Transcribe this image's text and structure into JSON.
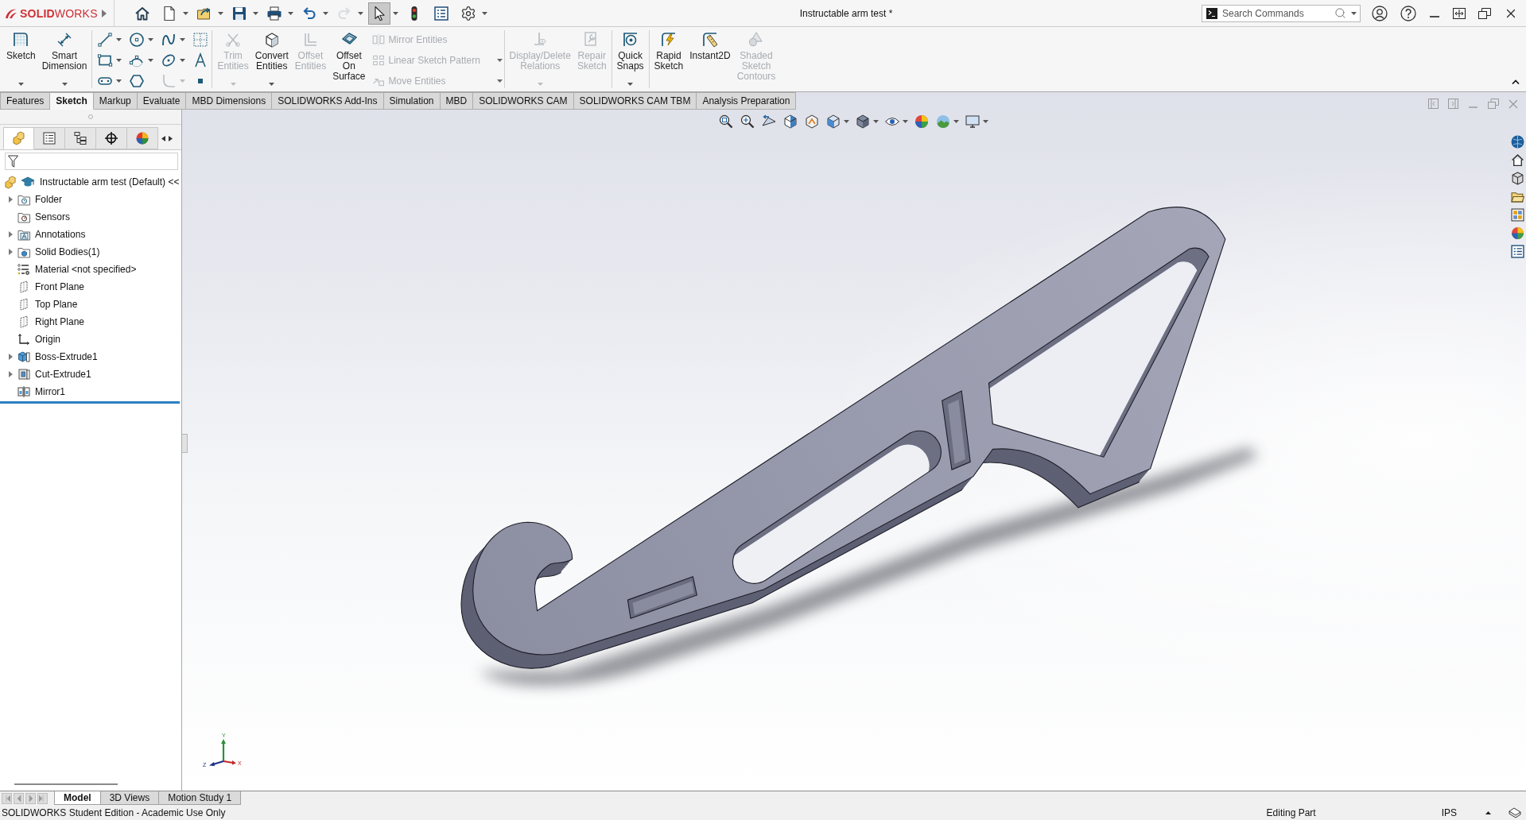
{
  "window": {
    "logo": "**SOLID**WORKS",
    "title": "Instructable arm test *"
  },
  "quick_access": [
    {
      "menu": false,
      "disabled": false,
      "pressed": false
    },
    {
      "menu": true,
      "disabled": false,
      "pressed": false
    },
    {
      "menu": true,
      "disabled": false,
      "pressed": false
    },
    {
      "menu": true,
      "disabled": false,
      "pressed": false
    },
    {
      "menu": true,
      "disabled": false,
      "pressed": false
    },
    {
      "menu": true,
      "disabled": false,
      "pressed": false
    },
    {
      "menu": true,
      "disabled": true,
      "pressed": false
    },
    {
      "menu": true,
      "disabled": false,
      "pressed": true
    },
    {
      "menu": false,
      "disabled": false,
      "pressed": false
    },
    {
      "menu": false,
      "disabled": false,
      "pressed": false
    },
    {
      "menu": true,
      "disabled": false,
      "pressed": false
    }
  ],
  "search": {
    "placeholder": "Search Commands"
  },
  "command_manager": {
    "groups": [
      {
        "items": [
          {
            "kind": "large",
            "label": "Sketch",
            "disabled": false,
            "menu": true
          },
          {
            "kind": "large",
            "label": "Smart Dimension",
            "disabled": false,
            "menu": true
          }
        ]
      },
      {
        "items": [
          {
            "kind": "tool",
            "disabled": false,
            "menu": true
          },
          {
            "kind": "tool",
            "disabled": false,
            "menu": true
          },
          {
            "kind": "tool",
            "disabled": false,
            "menu": true
          },
          {
            "kind": "tool",
            "disabled": false,
            "menu": false
          },
          {
            "kind": "tool",
            "disabled": false,
            "menu": true
          },
          {
            "kind": "tool",
            "disabled": false,
            "menu": true
          },
          {
            "kind": "tool",
            "disabled": false,
            "menu": true
          },
          {
            "kind": "tool",
            "disabled": false,
            "menu": false
          },
          {
            "kind": "tool",
            "disabled": false,
            "menu": true
          },
          {
            "kind": "tool",
            "disabled": false,
            "menu": false
          },
          {
            "kind": "tool",
            "disabled": true,
            "menu": true
          },
          {
            "kind": "tool",
            "disabled": false,
            "menu": false
          }
        ]
      },
      {
        "items": [
          {
            "kind": "large",
            "label": "Trim Entities",
            "disabled": true,
            "menu": true
          },
          {
            "kind": "large",
            "label": "Convert Entities",
            "disabled": false,
            "menu": true
          },
          {
            "kind": "large",
            "label": "Offset Entities",
            "disabled": true,
            "menu": false
          },
          {
            "kind": "large",
            "label": "Offset On Surface",
            "disabled": false,
            "menu": false
          },
          {
            "kind": "row",
            "label": "Mirror Entities",
            "disabled": true,
            "menu": false
          },
          {
            "kind": "row",
            "label": "Linear Sketch Pattern",
            "disabled": true,
            "menu": true
          },
          {
            "kind": "row",
            "label": "Move Entities",
            "disabled": true,
            "menu": true
          }
        ]
      },
      {
        "items": [
          {
            "kind": "large",
            "label": "Display/Delete Relations",
            "disabled": true,
            "menu": true
          },
          {
            "kind": "large",
            "label": "Repair Sketch",
            "disabled": true,
            "menu": false
          }
        ]
      },
      {
        "items": [
          {
            "kind": "large",
            "label": "Quick Snaps",
            "disabled": false,
            "menu": true
          }
        ]
      },
      {
        "items": [
          {
            "kind": "large",
            "label": "Rapid Sketch",
            "disabled": false,
            "menu": false
          },
          {
            "kind": "large",
            "label": "Instant2D",
            "disabled": false,
            "menu": false
          },
          {
            "kind": "large",
            "label": "Shaded Sketch Contours",
            "disabled": true,
            "menu": false
          }
        ]
      }
    ]
  },
  "command_tabs": [
    {
      "label": "Features",
      "selected": false
    },
    {
      "label": "Sketch",
      "selected": true
    },
    {
      "label": "Markup",
      "selected": false
    },
    {
      "label": "Evaluate",
      "selected": false
    },
    {
      "label": "MBD Dimensions",
      "selected": false
    },
    {
      "label": "SOLIDWORKS Add-Ins",
      "selected": false
    },
    {
      "label": "Simulation",
      "selected": false
    },
    {
      "label": "MBD",
      "selected": false
    },
    {
      "label": "SOLIDWORKS CAM",
      "selected": false
    },
    {
      "label": "SOLIDWORKS CAM TBM",
      "selected": false
    },
    {
      "label": "Analysis Preparation",
      "selected": false
    }
  ],
  "feature_manager": {
    "tabs": [
      {
        "selected": true
      },
      {
        "selected": false
      },
      {
        "selected": false
      },
      {
        "selected": false
      },
      {
        "selected": false
      }
    ],
    "root": "Instructable arm test (Default) <<",
    "items": [
      {
        "label": "Folder",
        "kind": "folder",
        "expandable": true
      },
      {
        "label": "Sensors",
        "kind": "sensors",
        "expandable": false
      },
      {
        "label": "Annotations",
        "kind": "annotations",
        "expandable": true
      },
      {
        "label": "Solid Bodies(1)",
        "kind": "bodies",
        "expandable": true
      },
      {
        "label": "Material <not specified>",
        "kind": "material",
        "expandable": false
      },
      {
        "label": "Front Plane",
        "kind": "plane",
        "expandable": false
      },
      {
        "label": "Top Plane",
        "kind": "plane",
        "expandable": false
      },
      {
        "label": "Right Plane",
        "kind": "plane",
        "expandable": false
      },
      {
        "label": "Origin",
        "kind": "origin",
        "expandable": false
      },
      {
        "label": "Boss-Extrude1",
        "kind": "boss",
        "expandable": true
      },
      {
        "label": "Cut-Extrude1",
        "kind": "cut",
        "expandable": true
      },
      {
        "label": "Mirror1",
        "kind": "mirror",
        "expandable": false
      }
    ]
  },
  "viewport": {
    "triad": {
      "x": "X",
      "y": "Y",
      "z": "Z"
    }
  },
  "bottom_tabs": [
    {
      "label": "Model",
      "selected": true
    },
    {
      "label": "3D Views",
      "selected": false
    },
    {
      "label": "Motion Study 1",
      "selected": false
    }
  ],
  "status_bar": {
    "message": "SOLIDWORKS Student Edition - Academic Use Only",
    "mode": "Editing Part",
    "units": "IPS"
  }
}
